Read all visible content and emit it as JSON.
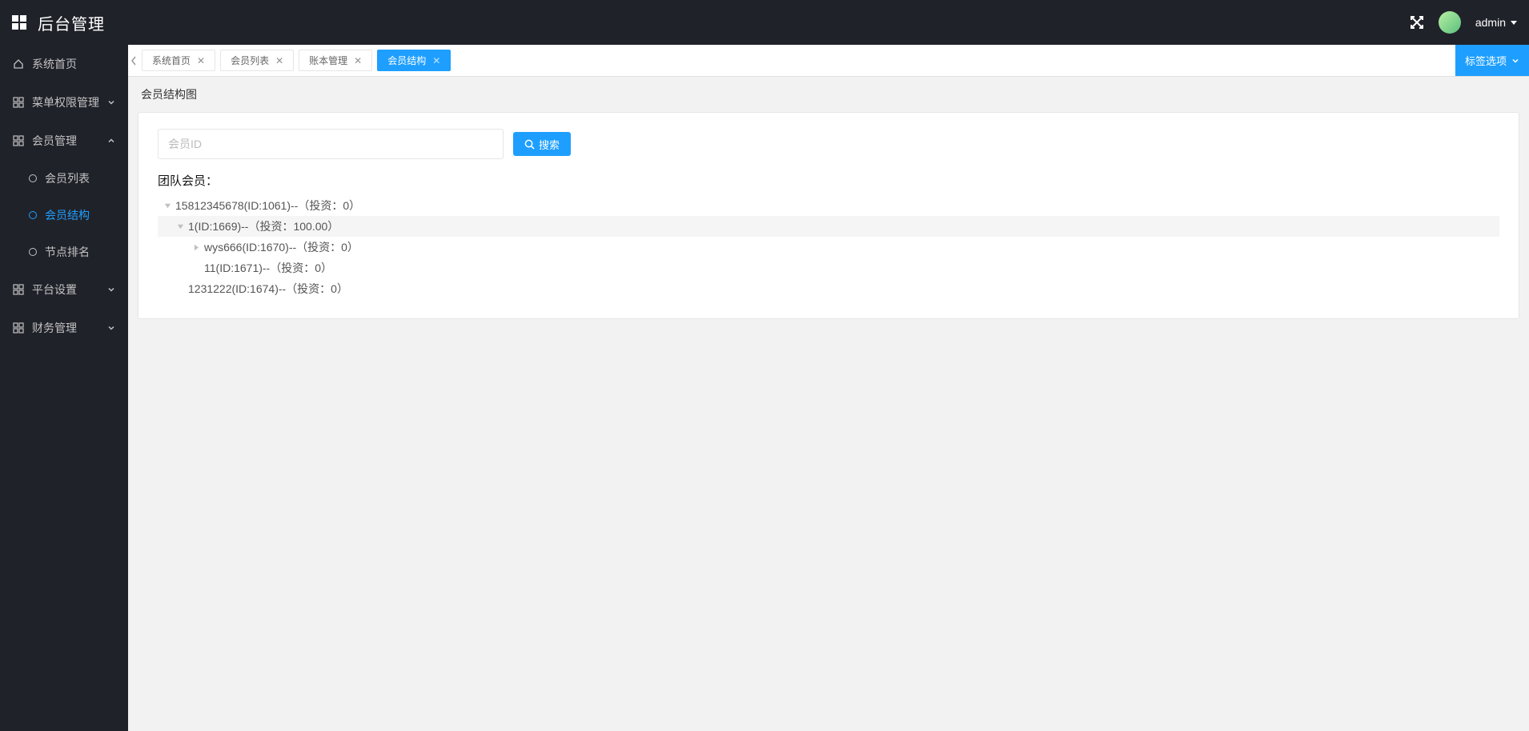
{
  "header": {
    "title": "后台管理",
    "username": "admin"
  },
  "sidebar": {
    "items": [
      {
        "label": "系统首页",
        "type": "item"
      },
      {
        "label": "菜单权限管理",
        "type": "group",
        "expanded": false
      },
      {
        "label": "会员管理",
        "type": "group",
        "expanded": true,
        "children": [
          {
            "label": "会员列表"
          },
          {
            "label": "会员结构",
            "active": true
          },
          {
            "label": "节点排名"
          }
        ]
      },
      {
        "label": "平台设置",
        "type": "group",
        "expanded": false
      },
      {
        "label": "财务管理",
        "type": "group",
        "expanded": false
      }
    ]
  },
  "tabs": {
    "items": [
      {
        "label": "系统首页"
      },
      {
        "label": "会员列表"
      },
      {
        "label": "账本管理"
      },
      {
        "label": "会员结构",
        "active": true
      }
    ],
    "options_label": "标签选项"
  },
  "page": {
    "title": "会员结构图",
    "search_placeholder": "会员ID",
    "search_btn": "搜索",
    "section_label": "团队会员：",
    "tree": [
      {
        "label": "15812345678(ID:1061)--（投资：0）",
        "level": 0,
        "toggle": "open"
      },
      {
        "label": "1(ID:1669)--（投资：100.00）",
        "level": 1,
        "toggle": "open",
        "hl": true
      },
      {
        "label": "wys666(ID:1670)--（投资：0）",
        "level": 2,
        "toggle": "closed"
      },
      {
        "label": "11(ID:1671)--（投资：0）",
        "level": 2,
        "toggle": "none"
      },
      {
        "label": "1231222(ID:1674)--（投资：0）",
        "level": 1,
        "toggle": "none"
      }
    ]
  }
}
